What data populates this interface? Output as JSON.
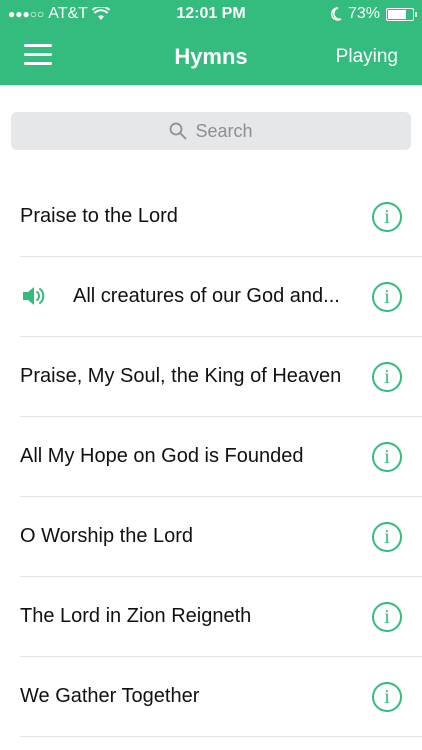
{
  "status_bar": {
    "carrier": "AT&T",
    "time": "12:01 PM",
    "battery": "73%",
    "battery_level": 0.73
  },
  "navbar": {
    "title": "Hymns",
    "playing_label": "Playing"
  },
  "search": {
    "placeholder": "Search"
  },
  "hymns": [
    {
      "title": "Praise to the Lord"
    },
    {
      "title": "All creatures of our God and..."
    },
    {
      "title": "Praise, My Soul, the King of Heaven"
    },
    {
      "title": "All My Hope on God is Founded"
    },
    {
      "title": "O Worship the Lord"
    },
    {
      "title": "The Lord in Zion Reigneth"
    },
    {
      "title": "We Gather Together"
    }
  ],
  "playing_index": 1,
  "colors": {
    "accent": "#33bc7e",
    "search_bg": "#e6e7e9"
  },
  "icons": {
    "menu": "menu-icon",
    "search": "search-icon",
    "speaker": "speaker-icon",
    "info": "info-icon"
  }
}
